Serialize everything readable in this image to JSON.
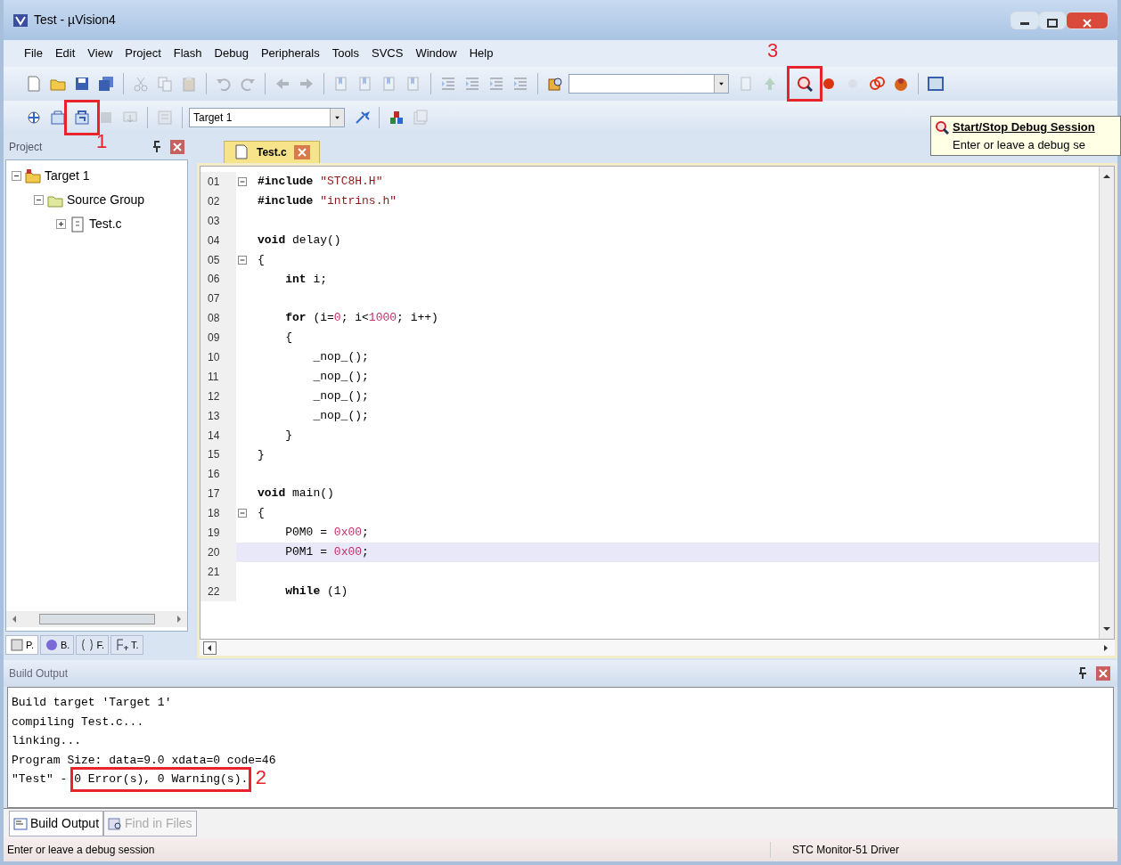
{
  "window": {
    "title": "Test - µVision4"
  },
  "menu": [
    "File",
    "Edit",
    "View",
    "Project",
    "Flash",
    "Debug",
    "Peripherals",
    "Tools",
    "SVCS",
    "Window",
    "Help"
  ],
  "toolbar_1": [
    {
      "kind": "button",
      "disabled": false
    },
    {
      "kind": "button",
      "disabled": false
    },
    {
      "kind": "button",
      "disabled": false
    },
    {
      "kind": "button",
      "disabled": false
    },
    {
      "kind": "separator"
    },
    {
      "kind": "button",
      "disabled": true
    },
    {
      "kind": "button",
      "disabled": true
    },
    {
      "kind": "button",
      "disabled": true
    },
    {
      "kind": "separator"
    },
    {
      "kind": "button",
      "disabled": true
    },
    {
      "kind": "button",
      "disabled": true
    },
    {
      "kind": "separator"
    },
    {
      "kind": "button",
      "disabled": true
    },
    {
      "kind": "button",
      "disabled": true
    },
    {
      "kind": "separator"
    },
    {
      "kind": "button",
      "disabled": true
    },
    {
      "kind": "button",
      "disabled": true
    },
    {
      "kind": "button",
      "disabled": true
    },
    {
      "kind": "button",
      "disabled": true
    },
    {
      "kind": "separator"
    },
    {
      "kind": "button",
      "disabled": true
    },
    {
      "kind": "button",
      "disabled": true
    },
    {
      "kind": "button",
      "disabled": true
    },
    {
      "kind": "button",
      "disabled": true
    },
    {
      "kind": "separator"
    },
    {
      "kind": "button",
      "disabled": false
    },
    {
      "kind": "combo"
    },
    {
      "kind": "button",
      "disabled": true
    },
    {
      "kind": "button",
      "disabled": true
    },
    {
      "kind": "separator"
    },
    {
      "kind": "button",
      "disabled": false,
      "highlighted": true,
      "callout": "3"
    },
    {
      "kind": "button",
      "disabled": false
    },
    {
      "kind": "button",
      "disabled": true
    },
    {
      "kind": "button",
      "disabled": false
    },
    {
      "kind": "button",
      "disabled": false
    },
    {
      "kind": "separator"
    },
    {
      "kind": "button",
      "disabled": false
    }
  ],
  "toolbar_2": [
    {
      "kind": "button",
      "disabled": false
    },
    {
      "kind": "button",
      "disabled": false
    },
    {
      "kind": "button",
      "disabled": false,
      "highlighted": true,
      "callout": "1"
    },
    {
      "kind": "button",
      "disabled": true
    },
    {
      "kind": "button",
      "disabled": true
    },
    {
      "kind": "separator"
    },
    {
      "kind": "button",
      "disabled": true
    },
    {
      "kind": "separator"
    },
    {
      "kind": "combo",
      "value": "Target 1"
    },
    {
      "kind": "button",
      "disabled": false
    },
    {
      "kind": "separator"
    },
    {
      "kind": "button",
      "disabled": false
    },
    {
      "kind": "button",
      "disabled": true
    }
  ],
  "tooltip": {
    "title": "Start/Stop Debug Session",
    "text": "Enter or leave a debug se"
  },
  "project_panel": {
    "title": "Project",
    "tree": [
      {
        "label": "Target 1",
        "kind": "target",
        "expanded": true,
        "children": [
          {
            "label": "Source Group",
            "kind": "group",
            "expanded": true,
            "children": [
              {
                "label": "Test.c",
                "kind": "file",
                "expanded": false
              }
            ]
          }
        ]
      }
    ],
    "tabs": [
      {
        "label": "P.",
        "selected": true
      },
      {
        "label": "B.",
        "selected": false
      },
      {
        "label": "F.",
        "selected": false
      },
      {
        "label": "T.",
        "selected": false
      }
    ]
  },
  "editor": {
    "tabs": [
      {
        "label": "Test.c",
        "selected": true
      }
    ],
    "lines": [
      {
        "num": "01",
        "fold": true,
        "selected": false,
        "tokens": [
          {
            "t": "#include",
            "kind": "kw"
          },
          {
            "t": " \"STC8H.H\"",
            "kind": "str"
          }
        ]
      },
      {
        "num": "02",
        "fold": false,
        "selected": false,
        "tokens": [
          {
            "t": "#include",
            "kind": "kw"
          },
          {
            "t": " \"intrins.h\"",
            "kind": "str"
          }
        ]
      },
      {
        "num": "03",
        "fold": false,
        "selected": false
      },
      {
        "num": "04",
        "fold": false,
        "selected": false,
        "tokens": [
          {
            "t": "void",
            "kind": "kw"
          },
          {
            "t": " delay()"
          }
        ]
      },
      {
        "num": "05",
        "fold": true,
        "selected": false,
        "tokens": [
          {
            "t": "{"
          }
        ]
      },
      {
        "num": "06",
        "fold": false,
        "selected": false,
        "tokens": [
          {
            "t": "    int",
            "kind": "kw"
          },
          {
            "t": " i;"
          }
        ]
      },
      {
        "num": "07",
        "fold": false,
        "selected": false
      },
      {
        "num": "08",
        "fold": false,
        "selected": false,
        "tokens": [
          {
            "t": "    for",
            "kind": "kw"
          },
          {
            "t": " (i="
          },
          {
            "t": "0",
            "kind": "num"
          },
          {
            "t": "; i<"
          },
          {
            "t": "1000",
            "kind": "num"
          },
          {
            "t": "; i++)"
          }
        ]
      },
      {
        "num": "09",
        "fold": false,
        "selected": false,
        "tokens": [
          {
            "t": "    {"
          }
        ]
      },
      {
        "num": "10",
        "fold": false,
        "selected": false,
        "tokens": [
          {
            "t": "        _nop_();"
          }
        ]
      },
      {
        "num": "11",
        "fold": false,
        "selected": false,
        "tokens": [
          {
            "t": "        _nop_();"
          }
        ]
      },
      {
        "num": "12",
        "fold": false,
        "selected": false,
        "tokens": [
          {
            "t": "        _nop_();"
          }
        ]
      },
      {
        "num": "13",
        "fold": false,
        "selected": false,
        "tokens": [
          {
            "t": "        _nop_();"
          }
        ]
      },
      {
        "num": "14",
        "fold": false,
        "selected": false,
        "tokens": [
          {
            "t": "    }"
          }
        ]
      },
      {
        "num": "15",
        "fold": false,
        "selected": false,
        "tokens": [
          {
            "t": "}"
          }
        ]
      },
      {
        "num": "16",
        "fold": false,
        "selected": false
      },
      {
        "num": "17",
        "fold": false,
        "selected": false,
        "tokens": [
          {
            "t": "void",
            "kind": "kw"
          },
          {
            "t": " main()"
          }
        ]
      },
      {
        "num": "18",
        "fold": true,
        "selected": false,
        "tokens": [
          {
            "t": "{"
          }
        ]
      },
      {
        "num": "19",
        "fold": false,
        "selected": false,
        "tokens": [
          {
            "t": "    P0M0 = "
          },
          {
            "t": "0x00",
            "kind": "num"
          },
          {
            "t": ";"
          }
        ]
      },
      {
        "num": "20",
        "fold": false,
        "selected": true,
        "tokens": [
          {
            "t": "    P0M1 = "
          },
          {
            "t": "0x00",
            "kind": "num"
          },
          {
            "t": ";"
          }
        ]
      },
      {
        "num": "21",
        "fold": false,
        "selected": false
      },
      {
        "num": "22",
        "fold": false,
        "selected": false,
        "tokens": [
          {
            "t": "    while",
            "kind": "kw"
          },
          {
            "t": " (1)"
          }
        ]
      }
    ]
  },
  "build_output": {
    "title": "Build Output",
    "lines": [
      [
        {
          "text": "Build target 'Target 1'"
        }
      ],
      [
        {
          "text": "compiling Test.c..."
        }
      ],
      [
        {
          "text": "linking..."
        }
      ],
      [
        {
          "text": "Program Size: data=9.0 xdata=0 code=46"
        }
      ],
      [
        {
          "text": "\"Test\" - "
        },
        {
          "text": "0 Error(s), 0 Warning(s).",
          "highlighted": true,
          "callout": "2"
        }
      ]
    ],
    "tabs": [
      {
        "label": "Build Output",
        "selected": true
      },
      {
        "label": "Find in Files",
        "selected": false
      }
    ]
  },
  "status_bar": {
    "message": "Enter or leave a debug session",
    "driver": "STC Monitor-51 Driver"
  }
}
